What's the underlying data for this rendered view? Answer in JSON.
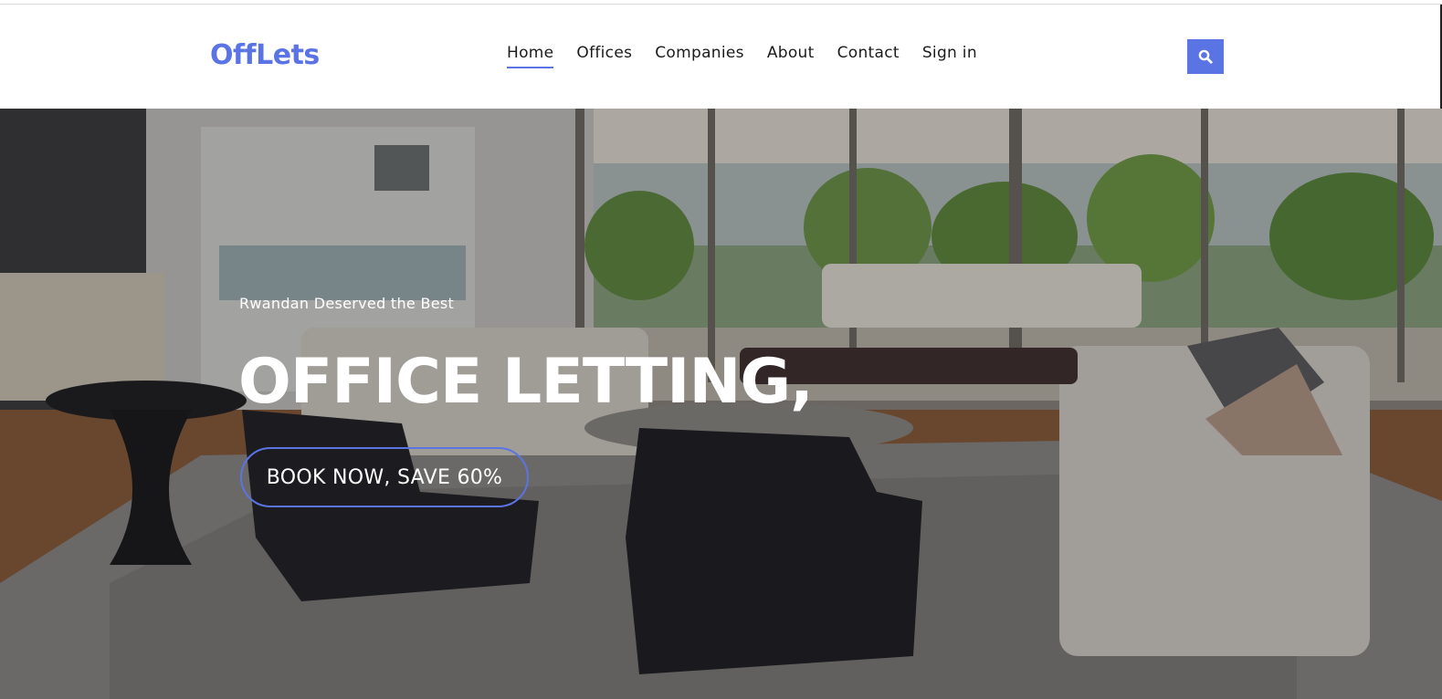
{
  "brand": {
    "logo": "OffLets",
    "accent": "#5b74e4"
  },
  "nav": {
    "items": [
      {
        "label": "Home",
        "active": true
      },
      {
        "label": "Offices",
        "active": false
      },
      {
        "label": "Companies",
        "active": false
      },
      {
        "label": "About",
        "active": false
      },
      {
        "label": "Contact",
        "active": false
      },
      {
        "label": "Sign in",
        "active": false
      }
    ],
    "search_icon": "search-icon"
  },
  "hero": {
    "subtitle": "Rwandan Deserved the Best",
    "title": "OFFICE LETTING,",
    "cta_label": "BOOK NOW, SAVE 60%",
    "background": "living-room-interior-photo"
  }
}
